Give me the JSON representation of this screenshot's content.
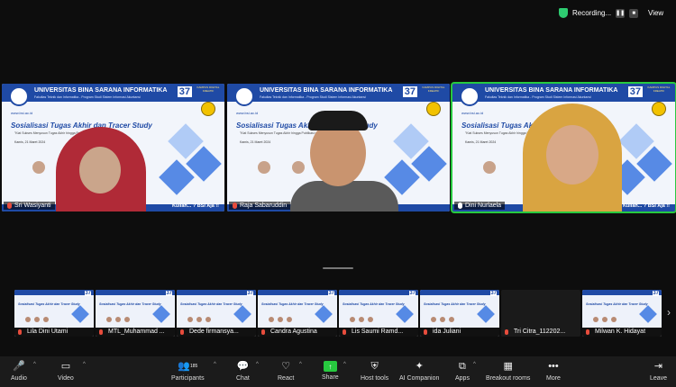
{
  "topbar": {
    "recording": "Recording...",
    "view": "View"
  },
  "slide": {
    "university": "UNIVERSITAS BINA SARANA INFORMATIKA",
    "faculty": "Fakultas Teknik dan Informatika - Program Studi Sistem Informasi Akuntansi",
    "anniversary": "37",
    "kampus": "KAMPUS DIGITAL KREATIF",
    "website": "www.bsi.ac.id",
    "title": "Sosialisasi Tugas Akhir dan Tracer Study",
    "subtitle": "\"Kiat Sukses Menyusun Tugas Akhir hingga Publikasi dan Strategi Publikasi\"",
    "date": "Kamis, 21 Maret 2024",
    "tagline": "Kuliah... ? BSI Aja !!"
  },
  "tiles": [
    {
      "name": "Sri Wasiyanti",
      "muted": true,
      "active": false
    },
    {
      "name": "Raja Sabaruddin",
      "muted": true,
      "active": false
    },
    {
      "name": "Dini Nurlaela",
      "muted": false,
      "active": true
    }
  ],
  "thumbnails": [
    {
      "name": "Lila Dini Utami"
    },
    {
      "name": "MTL_Muhammad ..."
    },
    {
      "name": "Dede firmansya..."
    },
    {
      "name": "Candra Agustina"
    },
    {
      "name": "Lis Saumi Ramd..."
    },
    {
      "name": "ida Juliani"
    },
    {
      "name": "Tri Citra_112202..."
    },
    {
      "name": "Milwan K. Hidayat"
    }
  ],
  "toolbar": {
    "audio": "Audio",
    "video": "Video",
    "participants": "Participants",
    "participants_count": "185",
    "chat": "Chat",
    "react": "React",
    "share": "Share",
    "host_tools": "Host tools",
    "ai_companion": "AI Companion",
    "apps": "Apps",
    "breakout_rooms": "Breakout rooms",
    "more": "More",
    "leave": "Leave"
  },
  "icons": {
    "shield": "shield-icon",
    "pause": "pause-icon",
    "stop": "stop-icon",
    "mic": "mic-muted-icon",
    "camera": "camera-icon",
    "participants": "participants-icon",
    "chat": "chat-icon",
    "react": "heart-icon",
    "share": "share-arrow-icon",
    "host": "shield-icon",
    "ai": "sparkle-icon",
    "apps": "apps-icon",
    "breakout": "grid-icon",
    "more": "dots-icon",
    "leave": "exit-icon"
  },
  "colors": {
    "accent": "#27c93f",
    "muted": "#e74c3c",
    "brand": "#1f4aa5"
  }
}
